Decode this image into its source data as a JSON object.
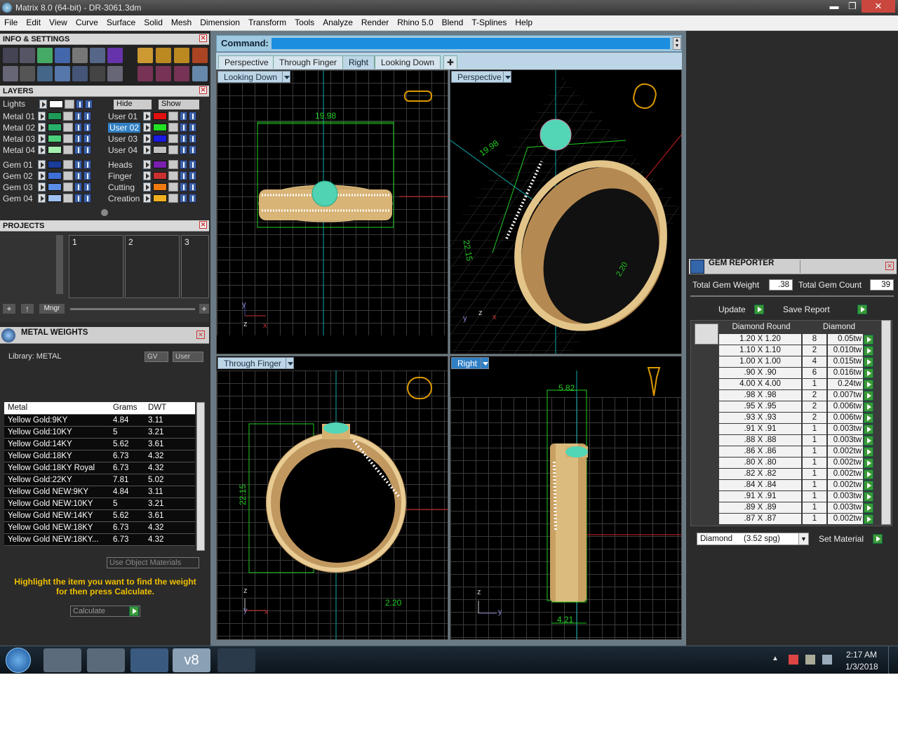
{
  "window": {
    "title": "Matrix 8.0 (64-bit) - DR-3061.3dm",
    "minimize": "▬",
    "restore": "❐",
    "close": "✕"
  },
  "menu": [
    "File",
    "Edit",
    "View",
    "Curve",
    "Surface",
    "Solid",
    "Mesh",
    "Dimension",
    "Transform",
    "Tools",
    "Analyze",
    "Render",
    "Rhino 5.0",
    "Blend",
    "T-Splines",
    "Help"
  ],
  "info_settings": {
    "title": "INFO & SETTINGS"
  },
  "layers": {
    "title": "LAYERS",
    "lights_label": "Lights",
    "hide_label": "Hide",
    "show_label": "Show",
    "left": [
      {
        "name": "Metal 01",
        "color": "#1d9a57"
      },
      {
        "name": "Metal 02",
        "color": "#28b06a"
      },
      {
        "name": "Metal 03",
        "color": "#4cd07a"
      },
      {
        "name": "Metal 04",
        "color": "#a6f0b0"
      },
      {
        "name": "Gem 01",
        "color": "#1a3c9a"
      },
      {
        "name": "Gem 02",
        "color": "#3f6fd6"
      },
      {
        "name": "Gem 03",
        "color": "#5a8ee8"
      },
      {
        "name": "Gem 04",
        "color": "#9ec0f2"
      }
    ],
    "right": [
      {
        "name": "User 01",
        "color": "#e01010"
      },
      {
        "name": "User 02",
        "color": "#22e022"
      },
      {
        "name": "User 03",
        "color": "#1a1ae0"
      },
      {
        "name": "User 04",
        "color": "#bfbfbf"
      },
      {
        "name": "Heads",
        "color": "#7a1fb0"
      },
      {
        "name": "Finger",
        "color": "#c83030"
      },
      {
        "name": "Cutting",
        "color": "#f07a10"
      },
      {
        "name": "Creation",
        "color": "#f0b020"
      }
    ]
  },
  "projects": {
    "title": "PROJECTS",
    "slots": [
      "1",
      "2",
      "3"
    ],
    "mngr_label": "Mngr",
    "add": "+",
    "up": "↑"
  },
  "metal_weights": {
    "title": "METAL WEIGHTS",
    "library": "Library: METAL",
    "gv": "GV",
    "user": "User",
    "columns": [
      "Metal",
      "Grams",
      "DWT"
    ],
    "rows": [
      [
        "Yellow Gold:9KY",
        "4.84",
        "3.11"
      ],
      [
        "Yellow Gold:10KY",
        "5",
        "3.21"
      ],
      [
        "Yellow Gold:14KY",
        "5.62",
        "3.61"
      ],
      [
        "Yellow Gold:18KY",
        "6.73",
        "4.32"
      ],
      [
        "Yellow Gold:18KY Royal",
        "6.73",
        "4.32"
      ],
      [
        "Yellow Gold:22KY",
        "7.81",
        "5.02"
      ],
      [
        "Yellow Gold NEW:9KY",
        "4.84",
        "3.11"
      ],
      [
        "Yellow Gold NEW:10KY",
        "5",
        "3.21"
      ],
      [
        "Yellow Gold NEW:14KY",
        "5.62",
        "3.61"
      ],
      [
        "Yellow Gold NEW:18KY",
        "6.73",
        "4.32"
      ],
      [
        "Yellow Gold NEW:18KY...",
        "6.73",
        "4.32"
      ]
    ],
    "use_object_materials": "Use Object Materials",
    "hint": "Highlight the item you want to find the weight for then press Calculate.",
    "calculate": "Calculate"
  },
  "command": {
    "label": "Command:"
  },
  "tabs": [
    "Perspective",
    "Through Finger",
    "Right",
    "Looking Down"
  ],
  "active_tab": "Right",
  "viewports": {
    "top_left": {
      "label": "Looking Down",
      "dim": "19.98"
    },
    "top_right": {
      "label": "Perspective",
      "dim1": "19.98",
      "dim2": "22.15",
      "dim3": "2.20"
    },
    "bottom_left": {
      "label": "Through Finger",
      "dim1": "22.15",
      "dim2": "2.20"
    },
    "bottom_right": {
      "label": "Right",
      "dim1": "5.82",
      "dim2": "4.21"
    },
    "axis": {
      "x": "x",
      "y": "y",
      "z": "z"
    }
  },
  "gem_reporter": {
    "title": "GEM REPORTER",
    "total_weight_label": "Total Gem Weight",
    "total_weight": ".38",
    "total_count_label": "Total Gem Count",
    "total_count": "39",
    "update": "Update",
    "save_report": "Save Report",
    "col_shape": "Diamond Round",
    "col_material": "Diamond",
    "rows": [
      [
        "1.20 X 1.20",
        "8",
        "0.05tw"
      ],
      [
        "1.10 X 1.10",
        "2",
        "0.010tw"
      ],
      [
        "1.00 X 1.00",
        "4",
        "0.015tw"
      ],
      [
        ".90 X .90",
        "6",
        "0.016tw"
      ],
      [
        "4.00 X 4.00",
        "1",
        "0.24tw"
      ],
      [
        ".98 X .98",
        "2",
        "0.007tw"
      ],
      [
        ".95 X .95",
        "2",
        "0.006tw"
      ],
      [
        ".93 X .93",
        "2",
        "0.006tw"
      ],
      [
        ".91 X .91",
        "1",
        "0.003tw"
      ],
      [
        ".88 X .88",
        "1",
        "0.003tw"
      ],
      [
        ".86 X .86",
        "1",
        "0.002tw"
      ],
      [
        ".80 X .80",
        "1",
        "0.002tw"
      ],
      [
        ".82 X .82",
        "1",
        "0.002tw"
      ],
      [
        ".84 X .84",
        "1",
        "0.002tw"
      ],
      [
        ".91 X .91",
        "1",
        "0.003tw"
      ],
      [
        ".89 X .89",
        "1",
        "0.003tw"
      ],
      [
        ".87 X .87",
        "1",
        "0.002tw"
      ]
    ],
    "material_select": "Diamond     (3.52 spg)",
    "set_material": "Set Material"
  },
  "taskbar": {
    "time": "2:17 AM",
    "date": "1/3/2018",
    "v8": "v8"
  }
}
